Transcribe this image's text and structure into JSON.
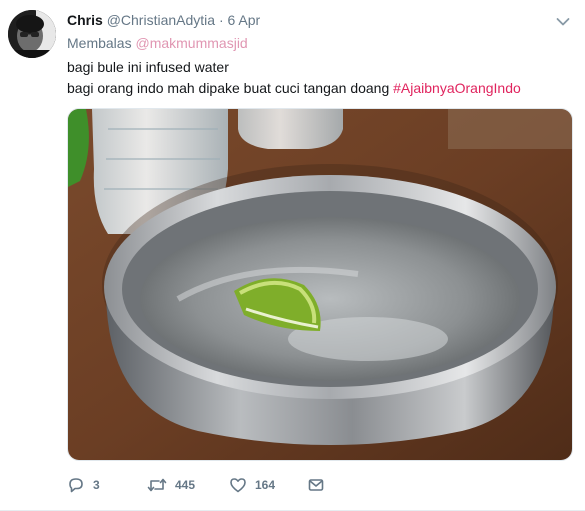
{
  "tweet": {
    "author_name": "Chris",
    "author_handle": "@ChristianAdytia",
    "separator": "·",
    "date": "6 Apr",
    "reply_prefix": "Membalas",
    "reply_mention": "@makmummasjid",
    "line1": "bagi bule ini infused water",
    "line2_text": "bagi orang indo mah dipake buat cuci tangan doang",
    "line2_hashtag": "#AjaibnyaOrangIndo",
    "media_icon": "photo-steel-bowl-with-lime"
  },
  "actions": {
    "reply_count": "3",
    "retweet_count": "445",
    "like_count": "164"
  },
  "colors": {
    "accent": "#e0245e",
    "muted": "#657786",
    "text": "#14171a"
  }
}
